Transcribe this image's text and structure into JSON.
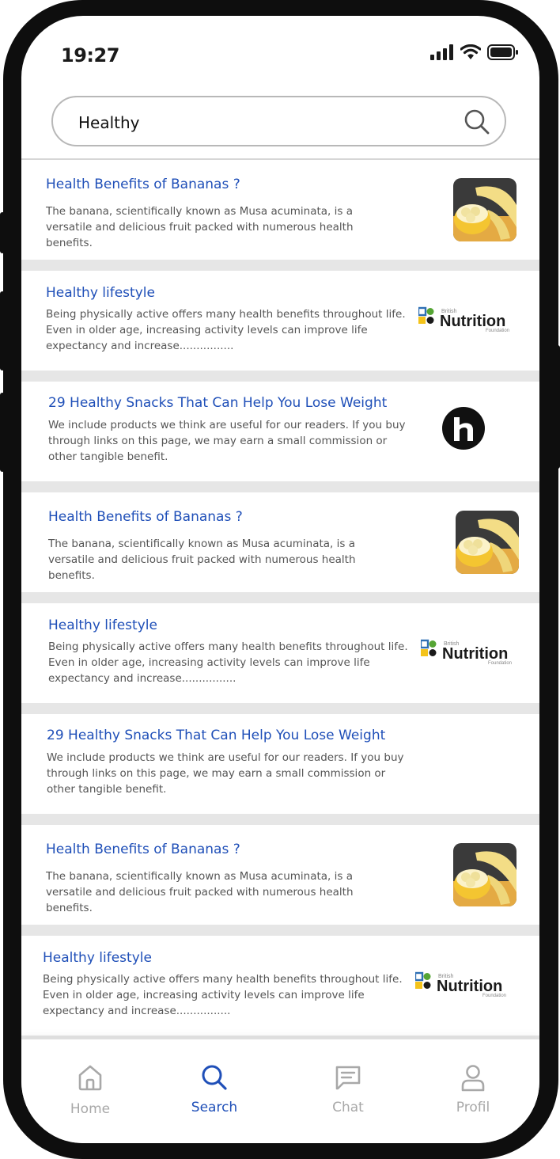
{
  "status": {
    "time": "19:27"
  },
  "search": {
    "query": "Healthy"
  },
  "results": [
    {
      "title": "Health Benefits of Bananas ?",
      "desc": "The banana, scientifically known as Musa acuminata, is a versatile and delicious fruit packed with numerous health benefits."
    },
    {
      "title": "Healthy lifestyle",
      "desc": "Being physically active offers many health benefits throughout life. Even in older age, increasing activity levels can improve life expectancy and increase................"
    },
    {
      "title": "29 Healthy Snacks That Can Help You Lose Weight",
      "desc": "We include products we think are useful for our readers. If you buy through links on this page, we may earn a small commission or other tangible benefit."
    },
    {
      "title": "Health Benefits of Bananas ?",
      "desc": "The banana, scientifically known as Musa acuminata, is a versatile and delicious fruit packed with numerous health benefits."
    },
    {
      "title": "Healthy lifestyle",
      "desc": "Being physically active offers many health benefits throughout life. Even in older age, increasing activity levels can improve life expectancy and increase................"
    },
    {
      "title": "29 Healthy Snacks That Can Help You Lose Weight",
      "desc": "We include products we think are useful for our readers. If you buy through links on this page, we may earn a small commission or other tangible benefit."
    },
    {
      "title": "Health Benefits of Bananas ?",
      "desc": "The banana, scientifically known as Musa acuminata, is a versatile and delicious fruit packed with numerous health benefits."
    },
    {
      "title": "Healthy lifestyle",
      "desc": "Being physically active offers many health benefits throughout life. Even in older age, increasing activity levels can improve life expectancy and increase................"
    }
  ],
  "logo": {
    "small": "British",
    "big": "Nutrition",
    "foot": "Foundation"
  },
  "tabs": [
    {
      "label": "Home",
      "icon": "home-icon"
    },
    {
      "label": "Search",
      "icon": "search-icon"
    },
    {
      "label": "Chat",
      "icon": "chat-icon"
    },
    {
      "label": "Profil",
      "icon": "profile-icon"
    }
  ],
  "colors": {
    "accent": "#1f4fb8",
    "inactive": "#a8a8a8",
    "separator": "#e6e6e6"
  }
}
